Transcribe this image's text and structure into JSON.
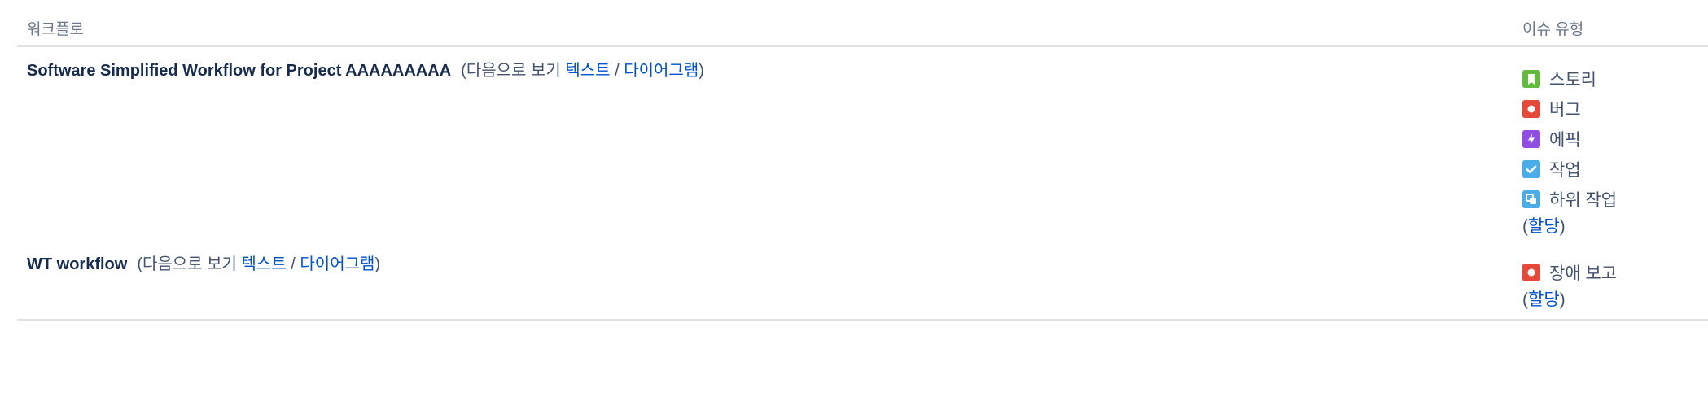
{
  "header": {
    "workflow_col": "워크플로",
    "issue_types_col": "이슈 유형"
  },
  "workflows": [
    {
      "name": "Software Simplified Workflow for Project AAAAAAAAA",
      "view_prefix": "(다음으로 보기 ",
      "text_link": "텍스트",
      "separator": " / ",
      "diagram_link": "다이어그램",
      "view_suffix": ")",
      "issue_types": [
        {
          "label": "스토리",
          "icon": "story-icon",
          "color": "#63ba3c"
        },
        {
          "label": "버그",
          "icon": "bug-icon",
          "color": "#e5493a"
        },
        {
          "label": "에픽",
          "icon": "epic-icon",
          "color": "#904ee2"
        },
        {
          "label": "작업",
          "icon": "task-icon",
          "color": "#4bade8"
        },
        {
          "label": "하위 작업",
          "icon": "subtask-icon",
          "color": "#4bade8"
        }
      ],
      "assign_open": "(",
      "assign_link": "할당",
      "assign_close": ")"
    },
    {
      "name": "WT workflow",
      "view_prefix": "(다음으로 보기 ",
      "text_link": "텍스트",
      "separator": " / ",
      "diagram_link": "다이어그램",
      "view_suffix": ")",
      "issue_types": [
        {
          "label": "장애 보고",
          "icon": "incident-icon",
          "color": "#e5493a"
        }
      ],
      "assign_open": "(",
      "assign_link": "할당",
      "assign_close": ")"
    }
  ]
}
